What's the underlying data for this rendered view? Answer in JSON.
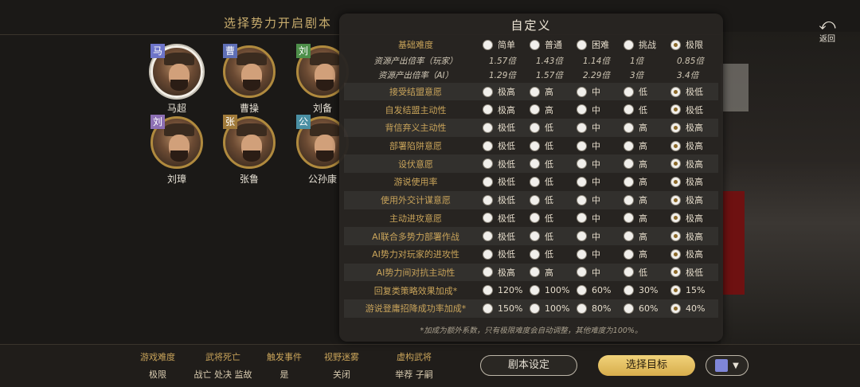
{
  "screen": {
    "title": "选择势力开启剧本",
    "back_label": "返回",
    "factions": [
      {
        "tag": "马",
        "name": "马超",
        "tag_color": "#6d74c9",
        "selected": true
      },
      {
        "tag": "曹",
        "name": "曹操",
        "tag_color": "#5f6fb6",
        "selected": false
      },
      {
        "tag": "刘",
        "name": "刘备",
        "tag_color": "#4e8f4a",
        "selected": false
      },
      {
        "tag": "刘",
        "name": "刘璋",
        "tag_color": "#8d6fb3",
        "selected": false
      },
      {
        "tag": "张",
        "name": "张鲁",
        "tag_color": "#a07a3a",
        "selected": false
      },
      {
        "tag": "公",
        "name": "公孙康",
        "tag_color": "#4a8fa3",
        "selected": false
      }
    ]
  },
  "bottom": {
    "settings": [
      {
        "key": "游戏难度",
        "value": "极限"
      },
      {
        "key": "武将死亡",
        "value": "战亡 处决 监故"
      },
      {
        "key": "触发事件",
        "value": "是"
      },
      {
        "key": "视野迷雾",
        "value": "关闭"
      },
      {
        "key": "虚构武将",
        "value": "举荐 子嗣"
      }
    ],
    "script_button": "剧本设定",
    "target_button": "选择目标",
    "faction_color": "#7f86d8"
  },
  "dialog": {
    "title": "自定义",
    "difficulty": {
      "label": "基础难度",
      "options": [
        "简单",
        "普通",
        "困难",
        "挑战",
        "极限"
      ],
      "selected": 4
    },
    "rates": [
      {
        "label": "资源产出倍率（玩家）",
        "values": [
          "1.57倍",
          "1.43倍",
          "1.14倍",
          "1倍",
          "0.85倍"
        ]
      },
      {
        "label": "资源产出倍率（AI）",
        "values": [
          "1.29倍",
          "1.57倍",
          "2.29倍",
          "3倍",
          "3.4倍"
        ]
      }
    ],
    "rows": [
      {
        "label": "接受结盟意愿",
        "options": [
          "极高",
          "高",
          "中",
          "低",
          "极低"
        ],
        "selected": 4
      },
      {
        "label": "自发结盟主动性",
        "options": [
          "极高",
          "高",
          "中",
          "低",
          "极低"
        ],
        "selected": 4
      },
      {
        "label": "背信弃义主动性",
        "options": [
          "极低",
          "低",
          "中",
          "高",
          "极高"
        ],
        "selected": 4
      },
      {
        "label": "部署陷阱意愿",
        "options": [
          "极低",
          "低",
          "中",
          "高",
          "极高"
        ],
        "selected": 4
      },
      {
        "label": "设伏意愿",
        "options": [
          "极低",
          "低",
          "中",
          "高",
          "极高"
        ],
        "selected": 4
      },
      {
        "label": "游说使用率",
        "options": [
          "极低",
          "低",
          "中",
          "高",
          "极高"
        ],
        "selected": 4
      },
      {
        "label": "使用外交计谋意愿",
        "options": [
          "极低",
          "低",
          "中",
          "高",
          "极高"
        ],
        "selected": 4
      },
      {
        "label": "主动进攻意愿",
        "options": [
          "极低",
          "低",
          "中",
          "高",
          "极高"
        ],
        "selected": 4
      },
      {
        "label": "AI联合多势力部署作战",
        "options": [
          "极低",
          "低",
          "中",
          "高",
          "极高"
        ],
        "selected": 4
      },
      {
        "label": "AI势力对玩家的进攻性",
        "options": [
          "极低",
          "低",
          "中",
          "高",
          "极高"
        ],
        "selected": 4
      },
      {
        "label": "AI势力间对抗主动性",
        "options": [
          "极高",
          "高",
          "中",
          "低",
          "极低"
        ],
        "selected": 4
      },
      {
        "label": "回复类策略效果加成*",
        "options": [
          "120%",
          "100%",
          "60%",
          "30%",
          "15%"
        ],
        "selected": 4
      },
      {
        "label": "游说登庸招降成功率加成*",
        "options": [
          "150%",
          "100%",
          "80%",
          "60%",
          "40%"
        ],
        "selected": 4
      }
    ],
    "footnote": "*加成为额外系数，只有极限难度会自动调整，其他难度为100%。"
  }
}
